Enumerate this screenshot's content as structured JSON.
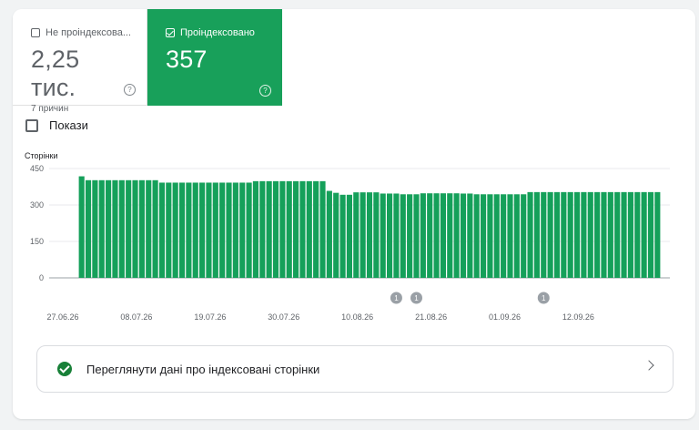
{
  "tiles": {
    "unindexed": {
      "label": "Не проіндексова...",
      "value": "2,25 тис.",
      "sub": "7 причин",
      "selected": false
    },
    "indexed": {
      "label": "Проіндексовано",
      "value": "357",
      "selected": true
    }
  },
  "show_toggle": {
    "label": "Покази",
    "checked": false
  },
  "colors": {
    "accent": "#18a05a",
    "bar": "#15a05a",
    "check": "#188038"
  },
  "chart_data": {
    "type": "bar",
    "ylabel": "Сторінки",
    "yticks": [
      0,
      150,
      300,
      450
    ],
    "ylim": [
      0,
      450
    ],
    "xticks": [
      "27.06.26",
      "08.07.26",
      "19.07.26",
      "30.07.26",
      "10.08.26",
      "21.08.26",
      "01.09.26",
      "12.09.26"
    ],
    "start_label": "27.06.26",
    "values": [
      418,
      402,
      402,
      402,
      402,
      402,
      402,
      402,
      402,
      402,
      402,
      402,
      392,
      392,
      392,
      392,
      392,
      392,
      392,
      392,
      392,
      392,
      392,
      392,
      392,
      392,
      398,
      398,
      398,
      398,
      398,
      398,
      398,
      398,
      398,
      398,
      398,
      358,
      350,
      342,
      342,
      352,
      352,
      352,
      352,
      347,
      347,
      347,
      344,
      344,
      344,
      348,
      348,
      348,
      348,
      348,
      348,
      347,
      347,
      344,
      344,
      344,
      344,
      344,
      344,
      344,
      344,
      353,
      353,
      353,
      353,
      353,
      353,
      353,
      353,
      353,
      353,
      353,
      353,
      353,
      353,
      353,
      353,
      353,
      353,
      353,
      353
    ],
    "annotations": [
      {
        "label": "1",
        "index": 47
      },
      {
        "label": "1",
        "index": 50
      },
      {
        "label": "1",
        "index": 69
      }
    ]
  },
  "details_link": {
    "label": "Переглянути дані про індексовані сторінки"
  }
}
